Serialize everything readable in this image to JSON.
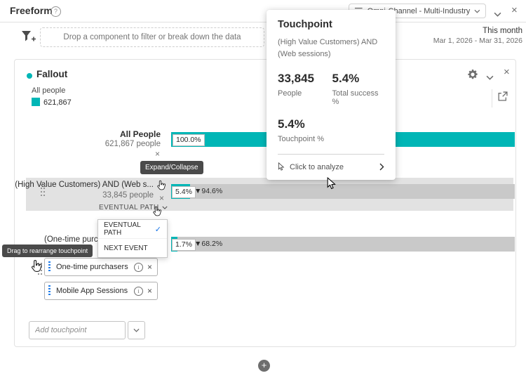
{
  "colors": {
    "accent_teal": "#00b6b6",
    "accent_blue": "#1473e6",
    "bar_gray": "#c9c9c9",
    "hover_band": "#e2e2e2",
    "tooltip_bg": "#4a4a4a"
  },
  "icons": {
    "help": "?",
    "close": "×",
    "remove": "×",
    "info": "i",
    "plus": "+",
    "check": "✓"
  },
  "header": {
    "title": "Freeform",
    "dataset_selector": "Omni-Channel - Multi-Industry"
  },
  "filter_bar": {
    "dropzone": "Drop a component to filter or break down the data",
    "range_label": "This month",
    "range_dates": "Mar 1, 2026 - Mar 31, 2026"
  },
  "panel": {
    "title": "Fallout",
    "legend_label": "All people",
    "legend_value": "621,867"
  },
  "fallout": {
    "type": "fallout-funnel",
    "path_type_label": "EVENTUAL PATH",
    "rows": [
      {
        "name": "All People",
        "people": "621,867 people",
        "pct": "100.0%",
        "bar_pct": 100
      },
      {
        "name": "(High Value Customers) AND (Web s...",
        "people": "33,845 people",
        "pct": "5.4%",
        "drop": "▼94.6%",
        "bar_pct": 5.4
      },
      {
        "name": "(One-time purcha...",
        "pct": "1.7%",
        "drop": "▼68.2%",
        "bar_pct": 1.7
      }
    ]
  },
  "path_menu": {
    "items": [
      {
        "label": "EVENTUAL PATH",
        "selected": true
      },
      {
        "label": "NEXT EVENT",
        "selected": false
      }
    ]
  },
  "tooltips": {
    "expand_collapse": "Expand/Collapse",
    "drag": "Drag to rearrange touchpoint"
  },
  "touchpoints": [
    {
      "label": "One-time purchasers"
    },
    {
      "label": "Mobile App Sessions"
    }
  ],
  "add_touchpoint_placeholder": "Add touchpoint",
  "popup": {
    "title": "Touchpoint",
    "subtitle": "(High Value Customers) AND (Web sessions)",
    "people_value": "33,845",
    "people_label": "People",
    "success_value": "5.4%",
    "success_label": "Total success %",
    "touchpoint_value": "5.4%",
    "touchpoint_label": "Touchpoint %",
    "action": "Click to analyze"
  }
}
